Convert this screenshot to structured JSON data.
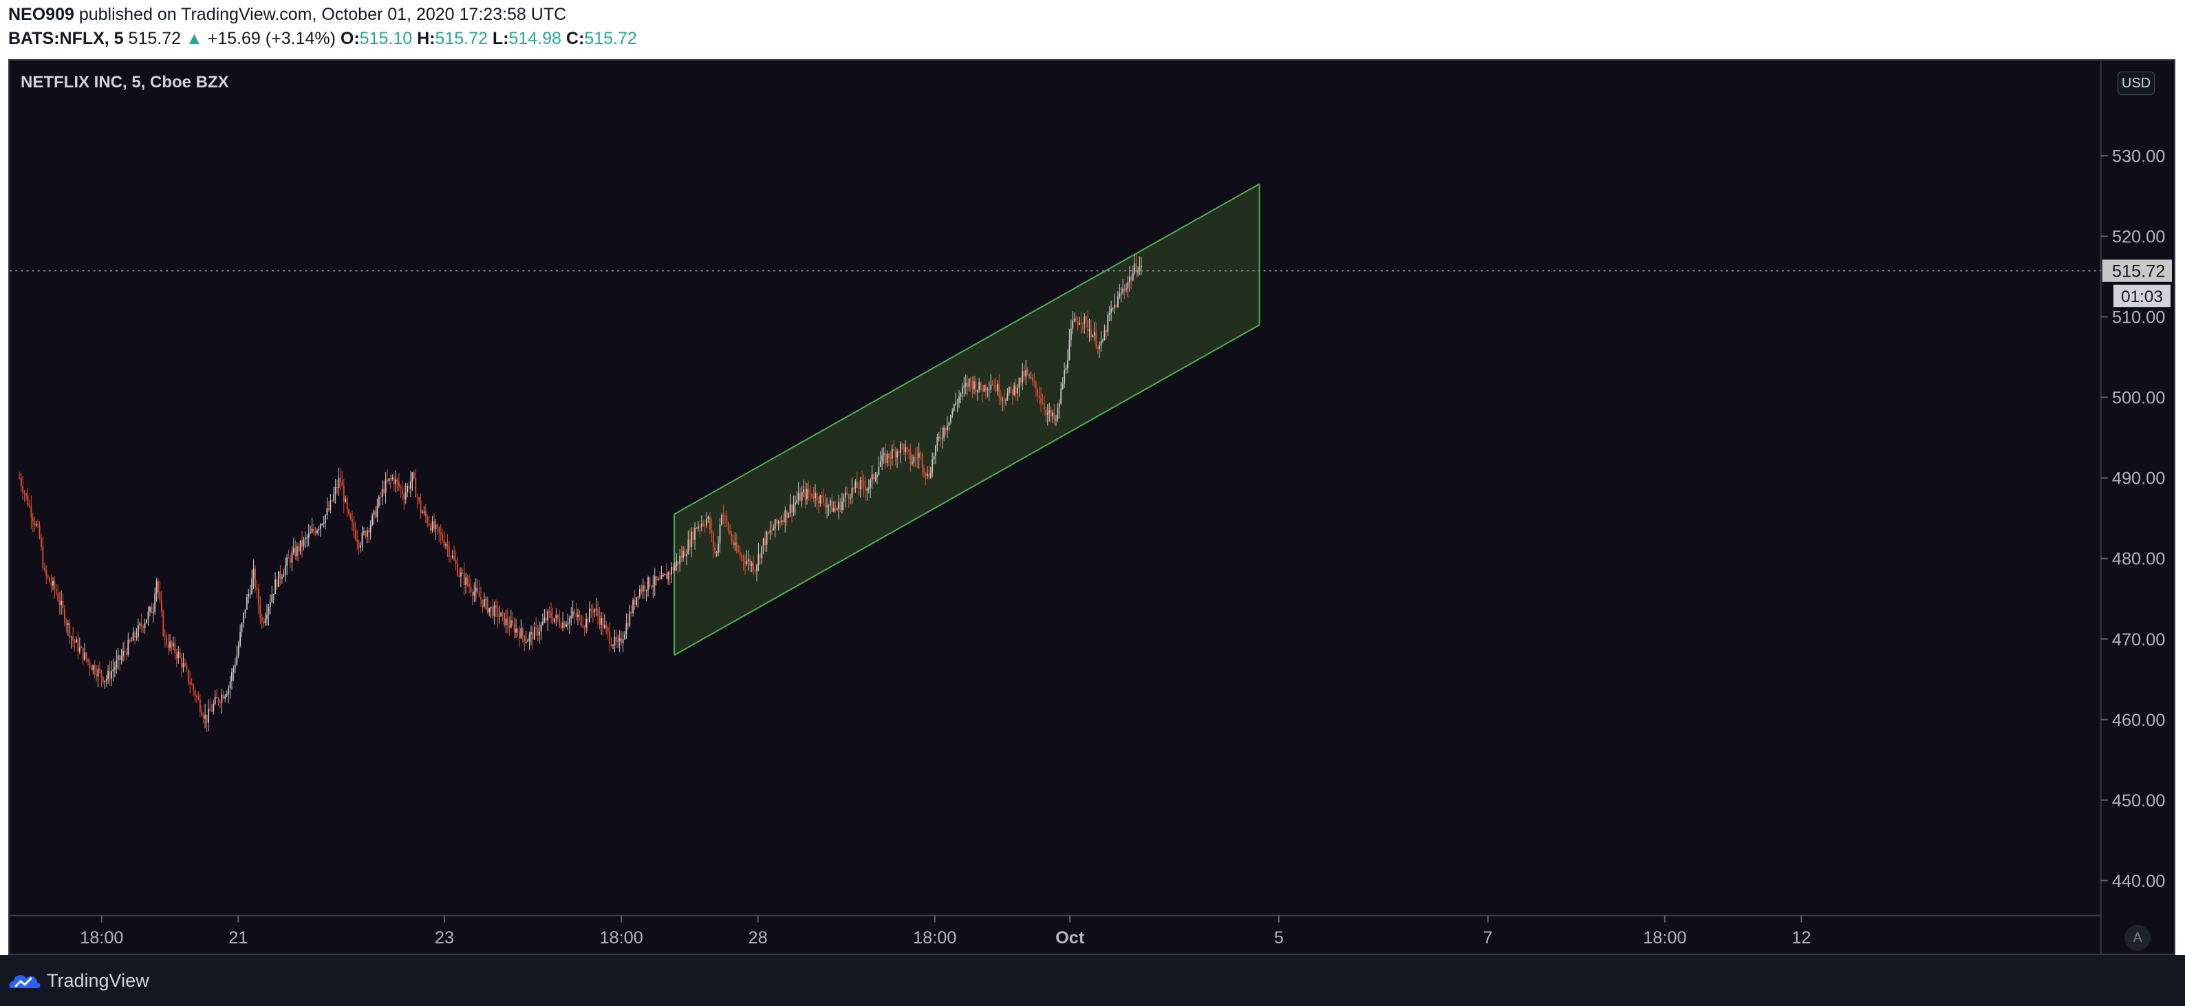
{
  "header": {
    "author": "NEO909",
    "publish_text": "published on TradingView.com, October 01, 2020 17:23:58 UTC",
    "symbol": "BATS:NFLX, 5",
    "last": "515.72",
    "change_arrow": "▲",
    "change": "+15.69 (+3.14%)",
    "open_label": "O:",
    "open": "515.10",
    "high_label": "H:",
    "high": "515.72",
    "low_label": "L:",
    "low": "514.98",
    "close_label": "C:",
    "close": "515.72"
  },
  "chart_title": "NETFLIX INC, 5, Cboe BZX",
  "currency": "USD",
  "auto_label": "A",
  "last_price_label": "515.72",
  "countdown_label": "01:03",
  "footer": {
    "brand": "TradingView",
    "icon": "tradingview-logo-icon"
  },
  "colors": {
    "background": "#0f0d17",
    "up": "#26a69a",
    "down": "#ef5350",
    "candle_up": "#c8c8c8",
    "candle_down": "#e04e2e",
    "channel_fill": "#2a3a22",
    "channel_line": "#4caf50"
  },
  "chart_data": {
    "type": "candlestick",
    "symbol": "BATS:NFLX",
    "interval": "5",
    "ylim": [
      435,
      535
    ],
    "y_ticks": [
      "530.00",
      "520.00",
      "510.00",
      "500.00",
      "490.00",
      "480.00",
      "470.00",
      "460.00",
      "450.00",
      "440.00"
    ],
    "x_ticks": [
      "18:00",
      "21",
      "23",
      "18:00",
      "28",
      "18:00",
      "Oct",
      "5",
      "7",
      "18:00",
      "12"
    ],
    "path": [
      [
        0,
        490
      ],
      [
        8,
        486
      ],
      [
        14,
        483
      ],
      [
        18,
        478
      ],
      [
        26,
        476
      ],
      [
        38,
        470
      ],
      [
        50,
        467
      ],
      [
        62,
        465
      ],
      [
        74,
        468
      ],
      [
        85,
        471
      ],
      [
        96,
        474
      ],
      [
        98,
        478
      ],
      [
        104,
        470
      ],
      [
        114,
        468
      ],
      [
        124,
        464
      ],
      [
        134,
        460
      ],
      [
        140,
        462
      ],
      [
        150,
        464
      ],
      [
        156,
        468
      ],
      [
        162,
        474
      ],
      [
        168,
        478
      ],
      [
        174,
        472
      ],
      [
        184,
        477
      ],
      [
        194,
        480
      ],
      [
        204,
        482
      ],
      [
        214,
        484
      ],
      [
        222,
        486
      ],
      [
        230,
        490
      ],
      [
        236,
        485
      ],
      [
        244,
        482
      ],
      [
        254,
        485
      ],
      [
        262,
        489
      ],
      [
        268,
        490
      ],
      [
        276,
        488
      ],
      [
        282,
        490
      ],
      [
        288,
        486
      ],
      [
        296,
        484
      ],
      [
        306,
        482
      ],
      [
        316,
        478
      ],
      [
        326,
        476
      ],
      [
        336,
        474
      ],
      [
        344,
        473
      ],
      [
        350,
        472
      ],
      [
        358,
        471
      ],
      [
        364,
        470
      ],
      [
        372,
        471
      ],
      [
        380,
        473
      ],
      [
        390,
        472
      ],
      [
        398,
        473
      ],
      [
        406,
        472
      ],
      [
        412,
        474
      ],
      [
        418,
        472
      ],
      [
        424,
        470
      ],
      [
        430,
        469
      ],
      [
        436,
        472
      ],
      [
        444,
        476
      ],
      [
        452,
        477
      ],
      [
        460,
        477
      ],
      [
        470,
        479
      ],
      [
        478,
        481
      ],
      [
        486,
        484
      ],
      [
        494,
        485
      ],
      [
        500,
        480
      ],
      [
        504,
        486
      ],
      [
        508,
        484
      ],
      [
        514,
        481
      ],
      [
        520,
        480
      ],
      [
        528,
        479
      ],
      [
        534,
        482
      ],
      [
        542,
        484
      ],
      [
        552,
        486
      ],
      [
        562,
        488
      ],
      [
        570,
        488
      ],
      [
        578,
        487
      ],
      [
        586,
        486
      ],
      [
        594,
        488
      ],
      [
        602,
        489
      ],
      [
        610,
        489
      ],
      [
        618,
        492
      ],
      [
        626,
        493
      ],
      [
        634,
        494
      ],
      [
        640,
        492
      ],
      [
        646,
        493
      ],
      [
        652,
        490
      ],
      [
        658,
        494
      ],
      [
        666,
        497
      ],
      [
        674,
        500
      ],
      [
        682,
        502
      ],
      [
        690,
        501
      ],
      [
        698,
        502
      ],
      [
        706,
        500
      ],
      [
        714,
        501
      ],
      [
        722,
        503
      ],
      [
        730,
        501
      ],
      [
        738,
        498
      ],
      [
        744,
        497
      ],
      [
        750,
        503
      ],
      [
        756,
        509
      ],
      [
        762,
        510
      ],
      [
        770,
        508
      ],
      [
        776,
        506
      ],
      [
        782,
        510
      ],
      [
        788,
        512
      ],
      [
        794,
        514
      ],
      [
        798,
        515
      ],
      [
        802,
        516.5
      ],
      [
        806,
        515.72
      ]
    ],
    "channel": {
      "upper": [
        [
          470,
          485.5
        ],
        [
          890,
          526.5
        ]
      ],
      "lower": [
        [
          470,
          468
        ],
        [
          890,
          509
        ]
      ],
      "type": "parallel channel"
    },
    "last_price": 515.72
  }
}
